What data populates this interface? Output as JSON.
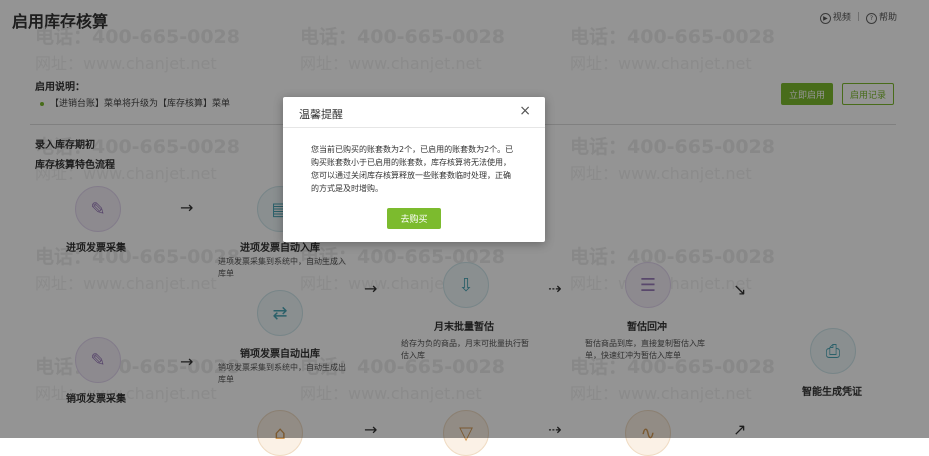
{
  "page": {
    "title": "启用库存核算",
    "video_label": "视频",
    "help_label": "帮助",
    "watermark_phone": "电话：400-665-0028",
    "watermark_site": "网址：www.chanjet.net"
  },
  "instructions": {
    "title": "启用说明：",
    "item": "【进销台账】菜单将升级为【库存核算】菜单"
  },
  "actions": {
    "enable": "立即启用",
    "record": "启用记录"
  },
  "sections": {
    "opening": "录入库存期初",
    "flow": "库存核算特色流程"
  },
  "flow": {
    "purchase_invoice": "进项发票采集",
    "purchase_stock_in": {
      "title": "进项发票自动入库",
      "desc": "进项发票采集到系统中，自动生成入库单"
    },
    "sales_stock_out": {
      "title": "销项发票自动出库",
      "desc": "销项发票采集到系统中，自动生成出库单"
    },
    "sales_invoice": "销项发票采集",
    "month_end_estimate": {
      "title": "月末批量暂估",
      "desc": "给存为负的商品，月末可批量执行暂估入库"
    },
    "estimate_reverse": {
      "title": "暂估回冲",
      "desc": "暂估商品到库，直接复制暂估入库单，快速红冲为暂估入库单"
    },
    "voucher": "智能生成凭证"
  },
  "modal": {
    "title": "温馨提醒",
    "close": "×",
    "body": "您当前已购买的账套数为2个，已启用的账套数为2个。已购买账套数小于已启用的账套数，库存核算将无法使用，您可以通过关闭库存核算释放一些账套数临时处理，正确的方式是及时增购。",
    "button": "去购买"
  },
  "colors": {
    "accent": "#7cbb2e",
    "overlay": "rgba(0,0,0,0.42)"
  }
}
